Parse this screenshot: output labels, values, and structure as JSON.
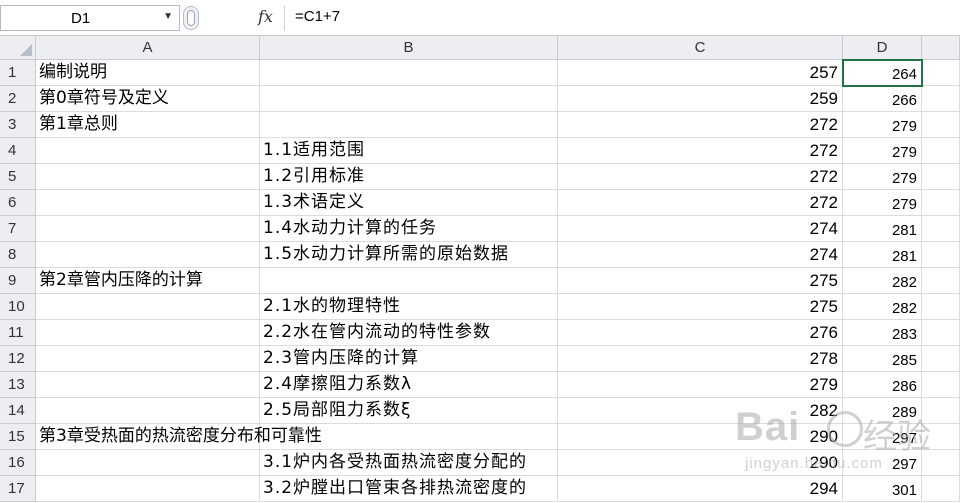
{
  "formula_bar": {
    "name_box": "D1",
    "fx_label": "fx",
    "formula": "=C1+7"
  },
  "columns": [
    "A",
    "B",
    "C",
    "D",
    ""
  ],
  "rows": [
    {
      "num": "1",
      "a": "编制说明",
      "b": "",
      "c": "257",
      "d": "264"
    },
    {
      "num": "2",
      "a": "第0章符号及定义",
      "b": "",
      "c": "259",
      "d": "266"
    },
    {
      "num": "3",
      "a": "第1章总则",
      "b": "",
      "c": "272",
      "d": "279"
    },
    {
      "num": "4",
      "a": "",
      "b": "1.1适用范围",
      "c": "272",
      "d": "279"
    },
    {
      "num": "5",
      "a": "",
      "b": "1.2引用标准",
      "c": "272",
      "d": "279"
    },
    {
      "num": "6",
      "a": "",
      "b": "1.3术语定义",
      "c": "272",
      "d": "279"
    },
    {
      "num": "7",
      "a": "",
      "b": "1.4水动力计算的任务",
      "c": "274",
      "d": "281"
    },
    {
      "num": "8",
      "a": "",
      "b": "1.5水动力计算所需的原始数据",
      "c": "274",
      "d": "281"
    },
    {
      "num": "9",
      "a": "第2章管内压降的计算",
      "b": "",
      "c": "275",
      "d": "282"
    },
    {
      "num": "10",
      "a": "",
      "b": "2.1水的物理特性",
      "c": "275",
      "d": "282"
    },
    {
      "num": "11",
      "a": "",
      "b": "2.2水在管内流动的特性参数",
      "c": "276",
      "d": "283"
    },
    {
      "num": "12",
      "a": "",
      "b": "2.3管内压降的计算",
      "c": "278",
      "d": "285"
    },
    {
      "num": "13",
      "a": "",
      "b": "2.4摩擦阻力系数λ",
      "c": "279",
      "d": "286"
    },
    {
      "num": "14",
      "a": "",
      "b": "2.5局部阻力系数ξ",
      "c": "282",
      "d": "289"
    },
    {
      "num": "15",
      "a": "第3章受热面的热流密度分布和可靠性",
      "b": "",
      "c": "290",
      "d": "297"
    },
    {
      "num": "16",
      "a": "",
      "b": "3.1炉内各受热面热流密度分配的",
      "c": "290",
      "d": "297"
    },
    {
      "num": "17",
      "a": "",
      "b": "3.2炉膛出口管束各排热流密度的",
      "c": "294",
      "d": "301"
    }
  ],
  "watermark": {
    "brand": "Bai",
    "brand_cn": "经验",
    "url": "jingyan.baidu.com"
  }
}
